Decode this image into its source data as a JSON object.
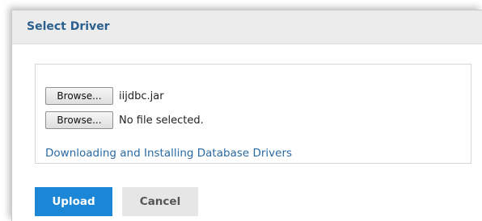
{
  "dialog": {
    "title": "Select Driver"
  },
  "files": [
    {
      "browse_label": "Browse...",
      "file_name": "iijdbc.jar"
    },
    {
      "browse_label": "Browse...",
      "file_name": "No file selected."
    }
  ],
  "help_link": "Downloading and Installing Database Drivers",
  "actions": {
    "upload_label": "Upload",
    "cancel_label": "Cancel"
  },
  "colors": {
    "title": "#2b5f8f",
    "link": "#2a6aa3",
    "primary": "#1b86d6",
    "secondary": "#e6e6e6"
  }
}
